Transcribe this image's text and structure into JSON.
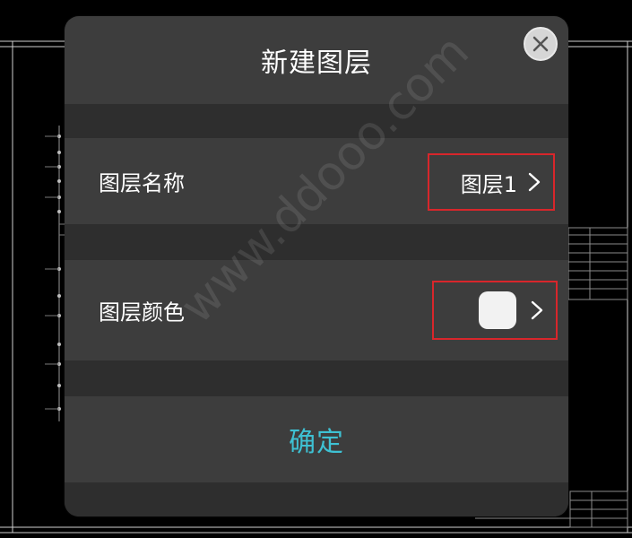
{
  "dialog": {
    "title": "新建图层",
    "layer_name": {
      "label": "图层名称",
      "value": "图层1"
    },
    "layer_color": {
      "label": "图层颜色",
      "color": "#f2f2f2"
    },
    "confirm_label": "确定"
  },
  "watermark": "www.ddooo.com",
  "colors": {
    "accent": "#3ec1d3",
    "highlight_border": "#d8262b",
    "dialog_bg": "#3d3d3d",
    "separator": "#2e2e2e"
  }
}
